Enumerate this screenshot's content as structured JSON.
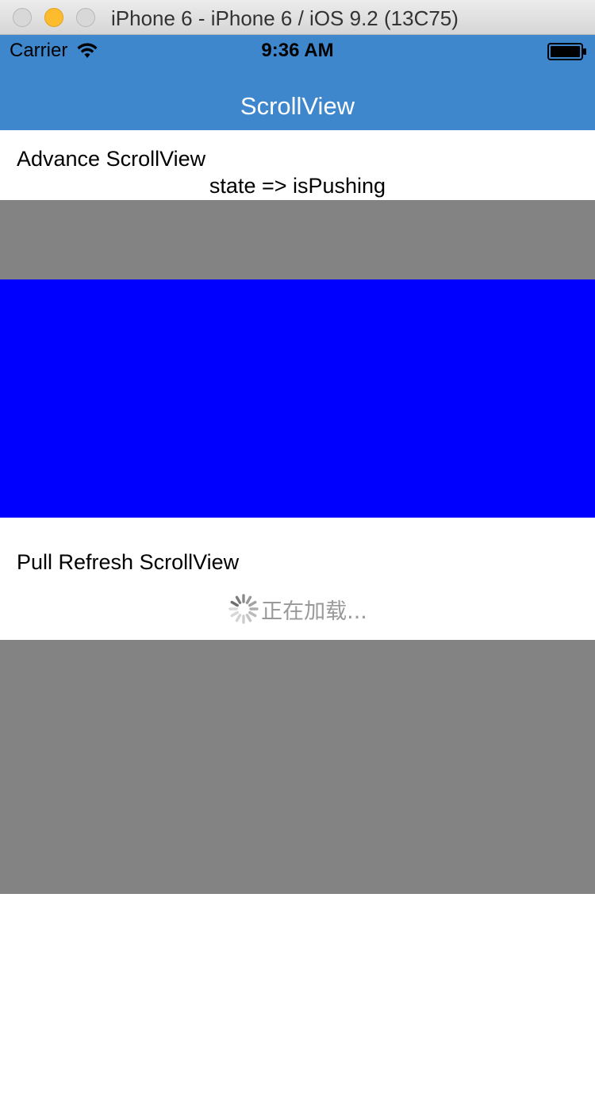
{
  "window": {
    "title": "iPhone 6 - iPhone 6 / iOS 9.2 (13C75)"
  },
  "status_bar": {
    "carrier": "Carrier",
    "time": "9:36 AM"
  },
  "nav": {
    "title": "ScrollView",
    "background_color": "#3e87cc"
  },
  "advance_section": {
    "label": "Advance ScrollView",
    "state_text": "state => isPushing",
    "panel_colors": [
      "#838383",
      "#0000ff"
    ]
  },
  "pull_refresh_section": {
    "label": "Pull Refresh ScrollView",
    "loading_text": "正在加载...",
    "panel_color": "#838383"
  },
  "icons": {
    "wifi": "wifi-icon",
    "battery": "battery-icon",
    "spinner": "spinner-icon"
  }
}
